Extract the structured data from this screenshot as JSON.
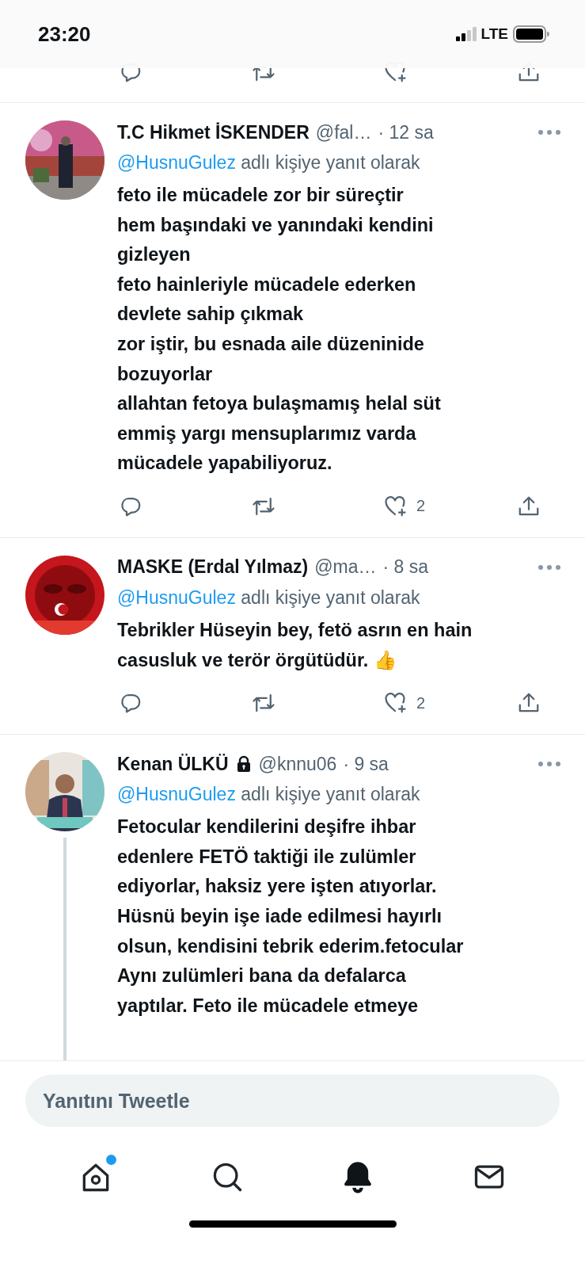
{
  "status_bar": {
    "time": "23:20",
    "network": "LTE"
  },
  "tweets": [
    {
      "name": "T.C Hikmet İSKENDER",
      "locked": false,
      "handle": "@fal…",
      "time": "· 12 sa",
      "reply_to": "@HusnuGulez",
      "reply_suffix": "adlı kişiye yanıt olarak",
      "thread": false,
      "like_count": "2",
      "lines": [
        "feto ile mücadele zor bir süreçtir",
        "hem başındaki ve yanındaki kendini",
        "gizleyen",
        "feto hainleriyle mücadele ederken",
        "devlete sahip çıkmak",
        "zor iştir, bu esnada aile düzeninide",
        "bozuyorlar",
        "allahtan fetoya bulaşmamış helal süt",
        "emmiş yargı mensuplarımız varda",
        "mücadele yapabiliyoruz."
      ]
    },
    {
      "name": "MASKE (Erdal Yılmaz)",
      "locked": false,
      "handle": "@ma…",
      "time": "· 8 sa",
      "reply_to": "@HusnuGulez",
      "reply_suffix": "adlı kişiye yanıt olarak",
      "thread": false,
      "like_count": "2",
      "lines": [
        "Tebrikler Hüseyin bey, fetö asrın en hain",
        "casusluk ve terör örgütüdür. 👍"
      ]
    },
    {
      "name": "Kenan ÜLKÜ",
      "locked": true,
      "handle": "@knnu06",
      "time": "· 9 sa",
      "reply_to": "@HusnuGulez",
      "reply_suffix": "adlı kişiye yanıt olarak",
      "thread": true,
      "lines": [
        "Fetocular kendilerini deşifre ihbar",
        "edenlere FETÖ taktiği ile zulümler",
        "ediyorlar, haksiz yere işten atıyorlar.",
        "Hüsnü beyin işe iade edilmesi hayırlı",
        "olsun, kendisini tebrik ederim.fetocular",
        "Aynı zulümleri bana da defalarca",
        "yaptılar. Feto ile mücadele etmeye"
      ]
    }
  ],
  "composer": {
    "placeholder": "Yanıtını Tweetle"
  },
  "nav": [
    {
      "kind": "home",
      "selected": false,
      "badge": true
    },
    {
      "kind": "search",
      "selected": false,
      "badge": false
    },
    {
      "kind": "notifications",
      "selected": true,
      "badge": false
    },
    {
      "kind": "messages",
      "selected": false,
      "badge": false
    }
  ]
}
